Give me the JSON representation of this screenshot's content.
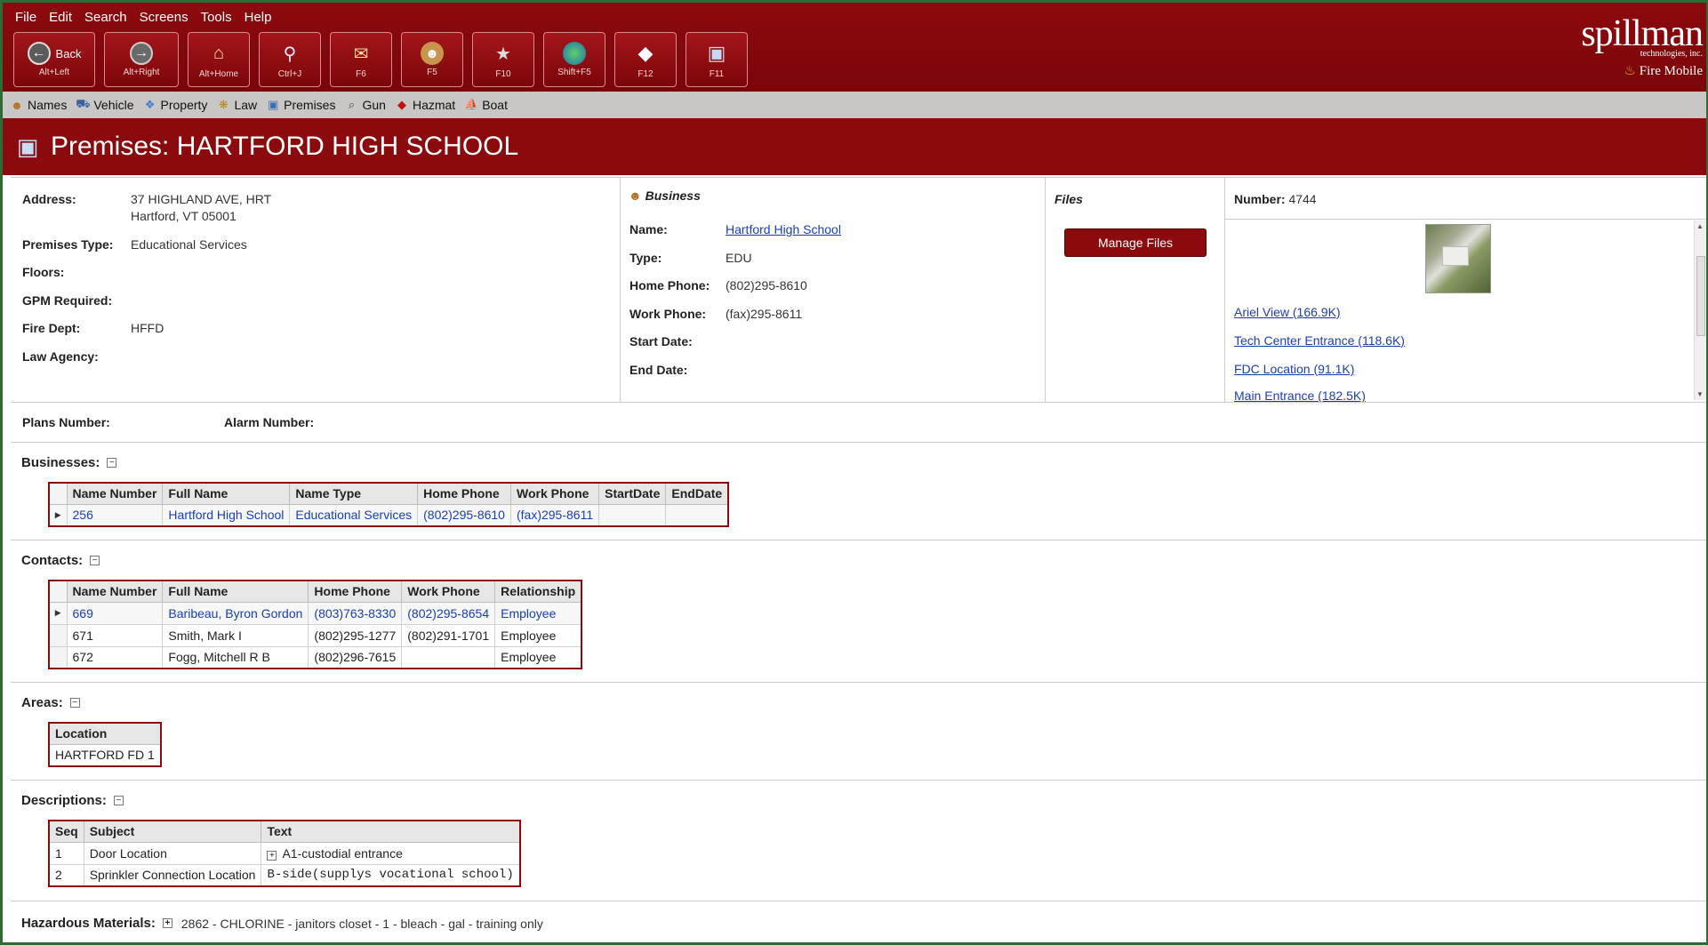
{
  "menu": [
    "File",
    "Edit",
    "Search",
    "Screens",
    "Tools",
    "Help"
  ],
  "toolbar": {
    "back": {
      "label": "Back",
      "key": "Alt+Left"
    },
    "forward": {
      "key": "Alt+Right"
    },
    "home": {
      "key": "Alt+Home"
    },
    "search": {
      "key": "Ctrl+J"
    },
    "mail": {
      "key": "F6"
    },
    "agent": {
      "key": "F5"
    },
    "star": {
      "key": "F10"
    },
    "globe": {
      "key": "Shift+F5"
    },
    "hazmat": {
      "key": "F12"
    },
    "premises": {
      "key": "F11"
    }
  },
  "logo": {
    "brand": "spillman",
    "sub": "technologies, inc.",
    "product": "Fire Mobile"
  },
  "nav": [
    "Names",
    "Vehicle",
    "Property",
    "Law",
    "Premises",
    "Gun",
    "Hazmat",
    "Boat"
  ],
  "title": "Premises: HARTFORD HIGH SCHOOL",
  "premises": {
    "address_label": "Address:",
    "address_line1": "37 HIGHLAND AVE, HRT",
    "address_line2": "Hartford, VT 05001",
    "type_label": "Premises Type:",
    "type_value": "Educational Services",
    "floors_label": "Floors:",
    "gpm_label": "GPM Required:",
    "firedept_label": "Fire Dept:",
    "firedept_value": "HFFD",
    "law_label": "Law Agency:"
  },
  "business": {
    "header": "Business",
    "name_label": "Name:",
    "name_value": "Hartford High School",
    "type_label": "Type:",
    "type_value": "EDU",
    "home_label": "Home Phone:",
    "home_value": "(802)295-8610",
    "work_label": "Work Phone:",
    "work_value": "(fax)295-8611",
    "start_label": "Start Date:",
    "end_label": "End Date:"
  },
  "files": {
    "header": "Files",
    "manage_label": "Manage Files"
  },
  "attachments": {
    "number_label": "Number:",
    "number_value": "4744",
    "links": [
      "Ariel View (166.9K)",
      "Tech Center Entrance (118.6K)",
      "FDC Location (91.1K)",
      "Main Entrance (182.5K)"
    ]
  },
  "plans": {
    "plans_label": "Plans Number:",
    "alarm_label": "Alarm Number:"
  },
  "businesses": {
    "title": "Businesses:",
    "headers": [
      "Name Number",
      "Full Name",
      "Name Type",
      "Home Phone",
      "Work Phone",
      "StartDate",
      "EndDate"
    ],
    "rows": [
      [
        "256",
        "Hartford High School",
        "Educational Services",
        "(802)295-8610",
        "(fax)295-8611",
        "",
        ""
      ]
    ]
  },
  "contacts": {
    "title": "Contacts:",
    "headers": [
      "Name Number",
      "Full Name",
      "Home Phone",
      "Work Phone",
      "Relationship"
    ],
    "rows": [
      [
        "669",
        "Baribeau, Byron Gordon",
        "(803)763-8330",
        "(802)295-8654",
        "Employee"
      ],
      [
        "671",
        "Smith, Mark I",
        "(802)295-1277",
        "(802)291-1701",
        "Employee"
      ],
      [
        "672",
        "Fogg, Mitchell R B",
        "(802)296-7615",
        "",
        "Employee"
      ]
    ]
  },
  "areas": {
    "title": "Areas:",
    "headers": [
      "Location"
    ],
    "rows": [
      [
        "HARTFORD FD 1"
      ]
    ]
  },
  "descriptions": {
    "title": "Descriptions:",
    "headers": [
      "Seq",
      "Subject",
      "Text"
    ],
    "rows": [
      [
        "1",
        "Door Location",
        "A1-custodial entrance"
      ],
      [
        "2",
        "Sprinkler Connection Location",
        "B-side(supplys vocational school)"
      ]
    ]
  },
  "hazmat": {
    "title": "Hazardous Materials:",
    "value": "2862 - CHLORINE - janitors closet - 1 - bleach - gal - training only"
  }
}
